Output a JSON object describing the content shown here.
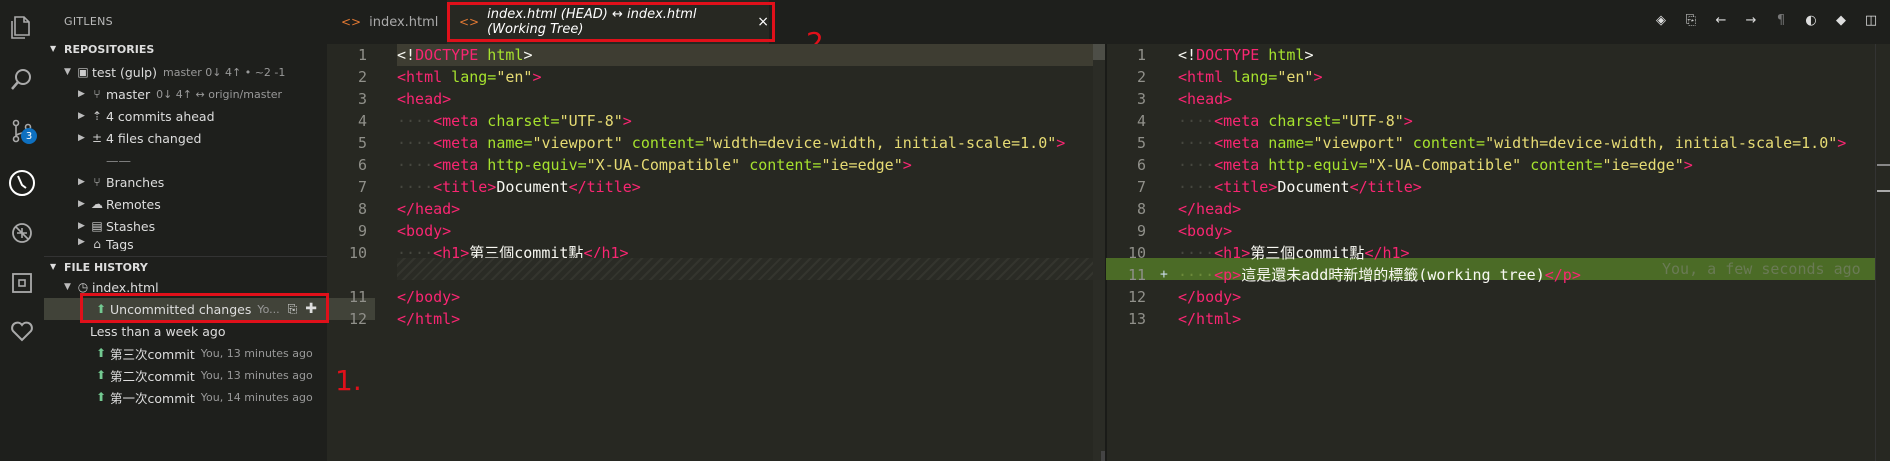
{
  "activity_bar": {
    "scm_badge": "3"
  },
  "sidebar": {
    "title": "GITLENS",
    "repositories": {
      "header": "REPOSITORIES",
      "repo_name": "test (gulp)",
      "repo_desc": "master 0↓ 4↑ • ~2 -1",
      "branch_name": "master",
      "branch_desc": "0↓ 4↑ ↔ origin/master",
      "commits_ahead": "4 commits ahead",
      "files_changed": "4 files changed",
      "separator": "——",
      "branches": "Branches",
      "remotes": "Remotes",
      "stashes": "Stashes",
      "tags": "Tags"
    },
    "file_history": {
      "header": "FILE HISTORY",
      "file": "index.html",
      "uncommitted": "Uncommitted changes",
      "uncommitted_desc": "Yo...",
      "group": "Less than a week ago",
      "commits": [
        {
          "label": "第三次commit",
          "desc": "You, 13 minutes ago"
        },
        {
          "label": "第二次commit",
          "desc": "You, 13 minutes ago"
        },
        {
          "label": "第一次commit",
          "desc": "You, 14 minutes ago"
        }
      ]
    }
  },
  "annotations": {
    "label1": "1.",
    "label2": "2."
  },
  "tabs": {
    "tab1": "index.html",
    "tab2": "index.html (HEAD) ↔ index.html (Working Tree)",
    "close": "×"
  },
  "left_editor": {
    "line_numbers": [
      "1",
      "2",
      "3",
      "4",
      "5",
      "6",
      "7",
      "8",
      "9",
      "10",
      "11",
      "12"
    ]
  },
  "right_editor": {
    "line_numbers": [
      "1",
      "2",
      "3",
      "4",
      "5",
      "6",
      "7",
      "8",
      "9",
      "10",
      "11",
      "12",
      "13"
    ],
    "added_marker": "+",
    "blame": "You, a few seconds ago"
  },
  "code": {
    "doctype_open": "<!",
    "doctype_kw": "DOCTYPE",
    "doctype_name": " html",
    "doctype_close": ">",
    "html_open": "<html",
    "lang_attr": " lang=",
    "lang_val": "\"en\"",
    "gt": ">",
    "head_open": "<head>",
    "meta": "<meta",
    "charset_attr": " charset=",
    "charset_val": "\"UTF-8\"",
    "name_attr": " name=",
    "name_val": "\"viewport\"",
    "content_attr": " content=",
    "content_val": "\"width=device-width, initial-scale=1.0\"",
    "httpequiv_attr": " http-equiv=",
    "httpequiv_val": "\"X-UA-Compatible\"",
    "content_val2": "\"ie=edge\"",
    "title_open": "<title>",
    "title_text": "Document",
    "title_close": "</title>",
    "head_close": "</head>",
    "body_open": "<body>",
    "h1_open": "<h1>",
    "h1_text": "第三個commit點",
    "h1_close": "</h1>",
    "p_open": "<p>",
    "p_text": "這是還未add時新增的標籤(working tree)",
    "p_close": "</p>",
    "body_close": "</body>",
    "html_close": "</html>",
    "indent": "····"
  }
}
